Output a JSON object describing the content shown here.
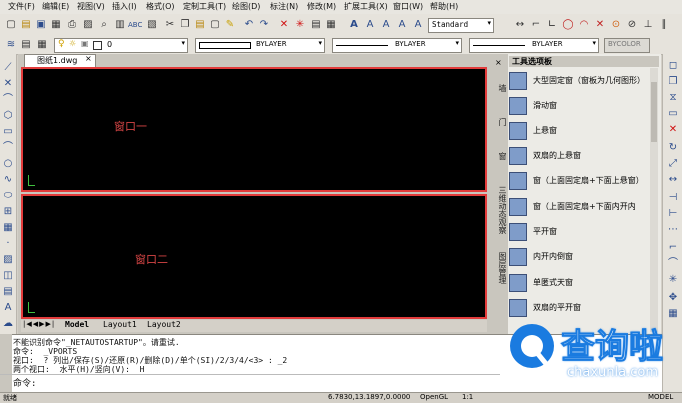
{
  "menu": [
    "文件(F)",
    "编辑(E)",
    "视图(V)",
    "插入(I)",
    "格式(O)",
    "定制工具(T)",
    "绘图(D)",
    "标注(N)",
    "修改(M)",
    "扩展工具(X)",
    "窗口(W)",
    "帮助(H)"
  ],
  "toolbar": {
    "text_style": "Standard",
    "layer": "0",
    "linetype1": "BYLAYER",
    "linetype2": "BYLAYER",
    "lineweight": "BYLAYER",
    "color": "BYCOLOR"
  },
  "document": {
    "tab_title": "图纸1.dwg",
    "tabs": [
      "Model",
      "Layout1",
      "Layout2"
    ]
  },
  "viewports": {
    "top_label": "窗口一",
    "bottom_label": "窗口二"
  },
  "palette": {
    "title": "工具选项板",
    "items": [
      "大型固定窗（窗板为几何图形）",
      "滑动窗",
      "上悬窗",
      "双扇的上悬窗",
      "窗（上面固定扇+下面上悬窗）",
      "窗（上面固定扇+下面内开内",
      "平开窗",
      "内开内倒窗",
      "单匿式天窗",
      "双扇的平开窗"
    ],
    "vertical_tabs": [
      "墙",
      "门",
      "窗",
      "三维动态观察",
      "图层管理"
    ]
  },
  "command": {
    "lines": [
      "不能识别命令\"_NETAUTOSTARTUP\"。请重试.",
      "命令:  _VPORTS",
      "视口:  ? 列出/保存(S)/还原(R)/删除(D)/单个(SI)/2/3/4/<3> : _2",
      "两个视口:  水平(H)/竖向(V):  H"
    ],
    "prompt": "命令:"
  },
  "status": {
    "left": "就绪",
    "coords": "6.7830,13.1897,0.0000",
    "opengl": "OpenGL",
    "scale": "1:1",
    "model": "MODEL"
  },
  "watermark": {
    "brand": "查询啦",
    "url": "chaxunla.com"
  },
  "colors": {
    "viewport_border": "#e23b3b",
    "label_red": "#d64545",
    "watermark_blue": "#1a7be0"
  }
}
